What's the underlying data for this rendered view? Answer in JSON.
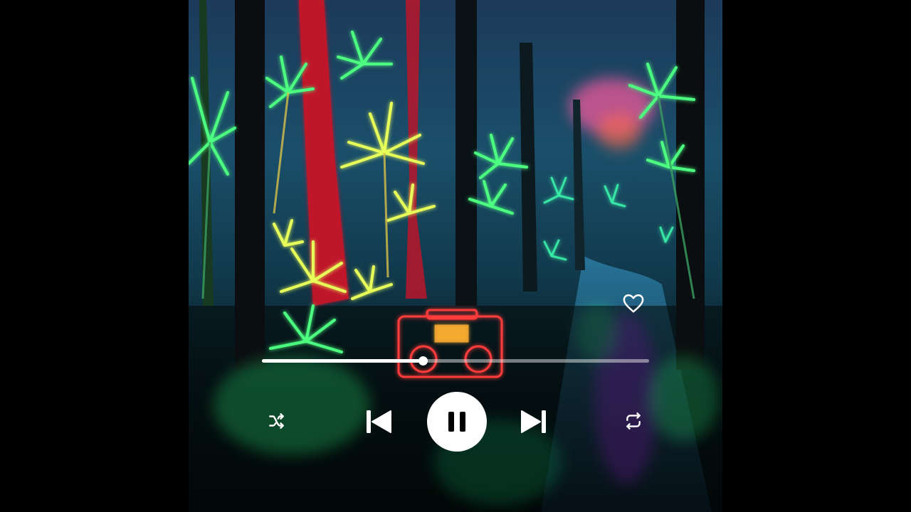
{
  "player": {
    "background": "neon-forest-album-art",
    "progress_fraction": 0.415,
    "is_playing": true,
    "liked": false,
    "icons": {
      "like": "heart-outline-icon",
      "shuffle": "shuffle-icon",
      "previous": "skip-previous-icon",
      "play_pause": "pause-icon",
      "next": "skip-next-icon",
      "repeat": "repeat-icon"
    },
    "colors": {
      "controls": "#ffffff",
      "track": "#ffffff73",
      "pause_glyph": "#000000"
    }
  }
}
